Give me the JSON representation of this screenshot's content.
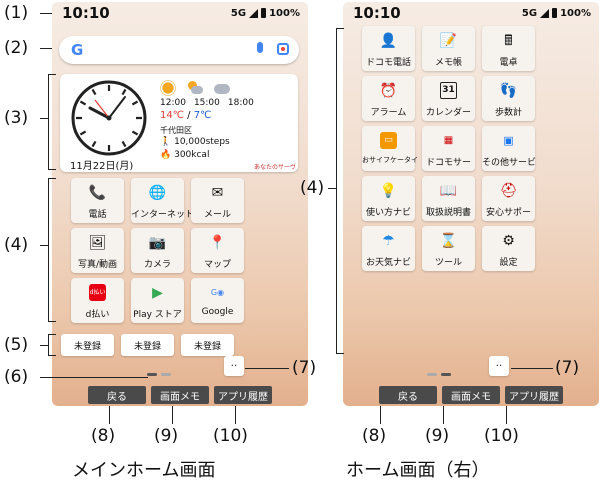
{
  "status": {
    "time": "10:10",
    "network": "5G",
    "battery": "100%"
  },
  "main_screen": {
    "widget": {
      "weather_times": [
        "12:00",
        "15:00",
        "18:00"
      ],
      "temp_high": "14℃",
      "temp_sep": "/",
      "temp_low": "7℃",
      "location": "千代田区",
      "steps": "10,000steps",
      "calories": "300kcal",
      "date": "11月22日(月)",
      "brand": "あなたのサーヴ"
    },
    "apps": [
      {
        "label": "電話",
        "icon": "phone-icon"
      },
      {
        "label": "インターネット",
        "icon": "globe-icon"
      },
      {
        "label": "メール",
        "icon": "mail-icon"
      },
      {
        "label": "写真/動画",
        "icon": "gallery-icon"
      },
      {
        "label": "カメラ",
        "icon": "camera-icon"
      },
      {
        "label": "マップ",
        "icon": "map-pin-icon"
      },
      {
        "label": "d払い",
        "icon": "d-barai-icon"
      },
      {
        "label": "Play ストア",
        "icon": "play-store-icon"
      },
      {
        "label": "Google",
        "icon": "google-folder-icon"
      }
    ],
    "unregistered": [
      "未登録",
      "未登録",
      "未登録"
    ],
    "dbarai_badge": "d払い"
  },
  "right_screen": {
    "apps": [
      {
        "label": "ドコモ電話",
        "icon": "docomo-contacts-icon"
      },
      {
        "label": "メモ帳",
        "icon": "memo-icon"
      },
      {
        "label": "電卓",
        "icon": "calculator-icon"
      },
      {
        "label": "アラーム",
        "icon": "alarm-icon"
      },
      {
        "label": "カレンダー",
        "icon": "calendar-icon"
      },
      {
        "label": "歩数計",
        "icon": "pedometer-icon"
      },
      {
        "label": "おサイフケータイ",
        "icon": "osaifu-icon"
      },
      {
        "label": "ドコモサー",
        "icon": "docomo-service-icon"
      },
      {
        "label": "その他サービ",
        "icon": "other-service-icon"
      },
      {
        "label": "使い方ナビ",
        "icon": "usage-navi-icon"
      },
      {
        "label": "取扱説明書",
        "icon": "manual-icon"
      },
      {
        "label": "安心サポー",
        "icon": "support-icon"
      },
      {
        "label": "お天気ナビ",
        "icon": "weather-navi-icon"
      },
      {
        "label": "ツール",
        "icon": "tools-folder-icon"
      },
      {
        "label": "設定",
        "icon": "settings-gear-icon"
      }
    ],
    "calendar_day": "31"
  },
  "navbar": {
    "back": "戻る",
    "screen_memo": "画面メモ",
    "app_history": "アプリ履歴"
  },
  "callouts": {
    "c1": "(1)",
    "c2": "(2)",
    "c3": "(3)",
    "c4": "(4)",
    "c5": "(5)",
    "c6": "(6)",
    "c7": "(7)",
    "c8": "(8)",
    "c9": "(9)",
    "c10": "(10)"
  },
  "captions": {
    "main": "メインホーム画面",
    "right": "ホーム画面（右）"
  },
  "colors": {
    "nav_button": "#4a4a4a",
    "temp_high": "#e53935",
    "temp_low": "#1e5bd8",
    "wallpaper_bottom": "#e3b08d"
  }
}
